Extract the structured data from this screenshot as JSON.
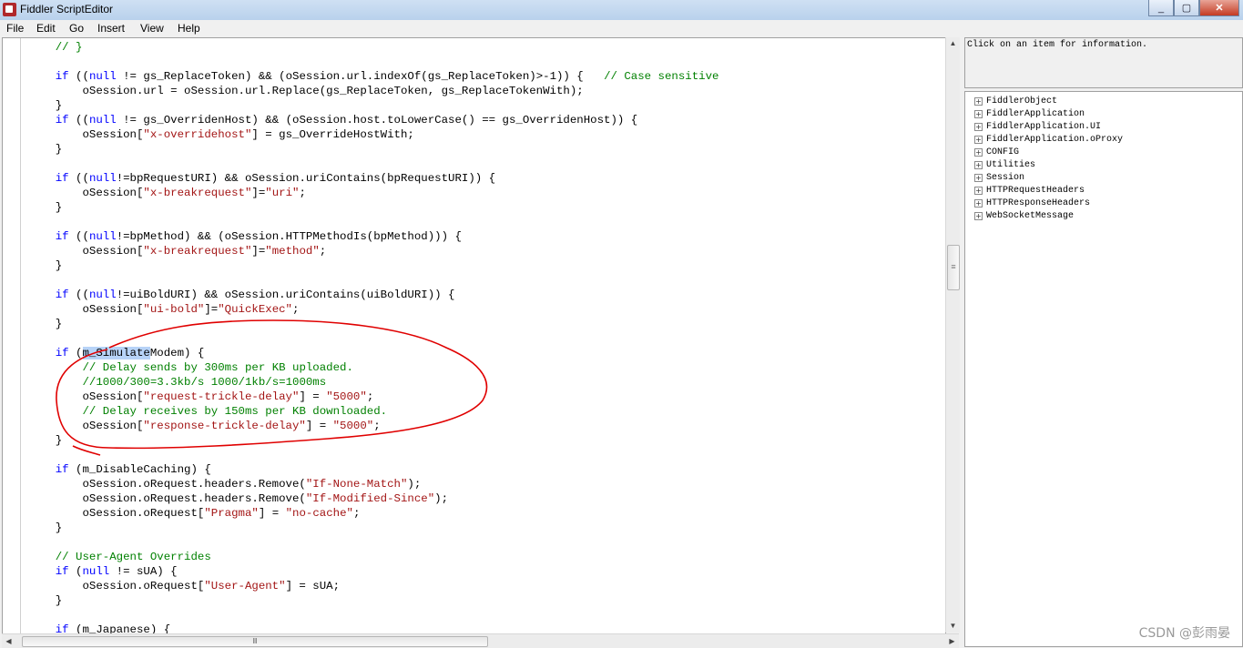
{
  "window": {
    "title": "Fiddler ScriptEditor",
    "minimize": "_",
    "maximize": "▢",
    "close": "✕"
  },
  "menu": [
    "File",
    "Edit",
    "Go",
    "Insert",
    "View",
    "Help"
  ],
  "code": {
    "lines": [
      [
        {
          "t": "    "
        },
        {
          "c": "cm",
          "t": "// }"
        }
      ],
      [
        {
          "t": ""
        }
      ],
      [
        {
          "t": "    "
        },
        {
          "c": "kw",
          "t": "if"
        },
        {
          "t": " (("
        },
        {
          "c": "kw",
          "t": "null"
        },
        {
          "t": " != gs_ReplaceToken) && (oSession.url.indexOf(gs_ReplaceToken)>-1)) {   "
        },
        {
          "c": "cm",
          "t": "// Case sensitive"
        }
      ],
      [
        {
          "t": "        oSession.url = oSession.url.Replace(gs_ReplaceToken, gs_ReplaceTokenWith);"
        }
      ],
      [
        {
          "t": "    }"
        }
      ],
      [
        {
          "t": "    "
        },
        {
          "c": "kw",
          "t": "if"
        },
        {
          "t": " (("
        },
        {
          "c": "kw",
          "t": "null"
        },
        {
          "t": " != gs_OverridenHost) && (oSession.host.toLowerCase() == gs_OverridenHost)) {"
        }
      ],
      [
        {
          "t": "        oSession["
        },
        {
          "c": "st",
          "t": "\"x-overridehost\""
        },
        {
          "t": "] = gs_OverrideHostWith;"
        }
      ],
      [
        {
          "t": "    }"
        }
      ],
      [
        {
          "t": ""
        }
      ],
      [
        {
          "t": "    "
        },
        {
          "c": "kw",
          "t": "if"
        },
        {
          "t": " (("
        },
        {
          "c": "kw",
          "t": "null"
        },
        {
          "t": "!=bpRequestURI) && oSession.uriContains(bpRequestURI)) {"
        }
      ],
      [
        {
          "t": "        oSession["
        },
        {
          "c": "st",
          "t": "\"x-breakrequest\""
        },
        {
          "t": "]="
        },
        {
          "c": "st",
          "t": "\"uri\""
        },
        {
          "t": ";"
        }
      ],
      [
        {
          "t": "    }"
        }
      ],
      [
        {
          "t": ""
        }
      ],
      [
        {
          "t": "    "
        },
        {
          "c": "kw",
          "t": "if"
        },
        {
          "t": " (("
        },
        {
          "c": "kw",
          "t": "null"
        },
        {
          "t": "!=bpMethod) && (oSession.HTTPMethodIs(bpMethod))) {"
        }
      ],
      [
        {
          "t": "        oSession["
        },
        {
          "c": "st",
          "t": "\"x-breakrequest\""
        },
        {
          "t": "]="
        },
        {
          "c": "st",
          "t": "\"method\""
        },
        {
          "t": ";"
        }
      ],
      [
        {
          "t": "    }"
        }
      ],
      [
        {
          "t": ""
        }
      ],
      [
        {
          "t": "    "
        },
        {
          "c": "kw",
          "t": "if"
        },
        {
          "t": " (("
        },
        {
          "c": "kw",
          "t": "null"
        },
        {
          "t": "!=uiBoldURI) && oSession.uriContains(uiBoldURI)) {"
        }
      ],
      [
        {
          "t": "        oSession["
        },
        {
          "c": "st",
          "t": "\"ui-bold\""
        },
        {
          "t": "]="
        },
        {
          "c": "st",
          "t": "\"QuickExec\""
        },
        {
          "t": ";"
        }
      ],
      [
        {
          "t": "    }"
        }
      ],
      [
        {
          "t": ""
        }
      ],
      [
        {
          "t": "    "
        },
        {
          "c": "kw",
          "t": "if"
        },
        {
          "t": " ("
        },
        {
          "c": "hl",
          "t": "m_Simulate"
        },
        {
          "t": "Modem) {"
        }
      ],
      [
        {
          "t": "        "
        },
        {
          "c": "cm",
          "t": "// Delay sends by 300ms per KB uploaded."
        }
      ],
      [
        {
          "t": "        "
        },
        {
          "c": "cm",
          "t": "//1000/300=3.3kb/s 1000/1kb/s=1000ms"
        }
      ],
      [
        {
          "t": "        oSession["
        },
        {
          "c": "st",
          "t": "\"request-trickle-delay\""
        },
        {
          "t": "] = "
        },
        {
          "c": "st",
          "t": "\"5000\""
        },
        {
          "t": ";"
        }
      ],
      [
        {
          "t": "        "
        },
        {
          "c": "cm",
          "t": "// Delay receives by 150ms per KB downloaded."
        }
      ],
      [
        {
          "t": "        oSession["
        },
        {
          "c": "st",
          "t": "\"response-trickle-delay\""
        },
        {
          "t": "] = "
        },
        {
          "c": "st",
          "t": "\"5000\""
        },
        {
          "t": ";"
        }
      ],
      [
        {
          "t": "    }"
        }
      ],
      [
        {
          "t": ""
        }
      ],
      [
        {
          "t": "    "
        },
        {
          "c": "kw",
          "t": "if"
        },
        {
          "t": " (m_DisableCaching) {"
        }
      ],
      [
        {
          "t": "        oSession.oRequest.headers.Remove("
        },
        {
          "c": "st",
          "t": "\"If-None-Match\""
        },
        {
          "t": ");"
        }
      ],
      [
        {
          "t": "        oSession.oRequest.headers.Remove("
        },
        {
          "c": "st",
          "t": "\"If-Modified-Since\""
        },
        {
          "t": ");"
        }
      ],
      [
        {
          "t": "        oSession.oRequest["
        },
        {
          "c": "st",
          "t": "\"Pragma\""
        },
        {
          "t": "] = "
        },
        {
          "c": "st",
          "t": "\"no-cache\""
        },
        {
          "t": ";"
        }
      ],
      [
        {
          "t": "    }"
        }
      ],
      [
        {
          "t": ""
        }
      ],
      [
        {
          "t": "    "
        },
        {
          "c": "cm",
          "t": "// User-Agent Overrides"
        }
      ],
      [
        {
          "t": "    "
        },
        {
          "c": "kw",
          "t": "if"
        },
        {
          "t": " ("
        },
        {
          "c": "kw",
          "t": "null"
        },
        {
          "t": " != sUA) {"
        }
      ],
      [
        {
          "t": "        oSession.oRequest["
        },
        {
          "c": "st",
          "t": "\"User-Agent\""
        },
        {
          "t": "] = sUA;"
        }
      ],
      [
        {
          "t": "    }"
        }
      ],
      [
        {
          "t": ""
        }
      ],
      [
        {
          "t": "    "
        },
        {
          "c": "kw",
          "t": "if"
        },
        {
          "t": " (m_Japanese) {"
        }
      ]
    ]
  },
  "info": {
    "text": "Click on an item for information."
  },
  "tree": {
    "items": [
      "FiddlerObject",
      "FiddlerApplication",
      "FiddlerApplication.UI",
      "FiddlerApplication.oProxy",
      "CONFIG",
      "Utilities",
      "Session",
      "HTTPRequestHeaders",
      "HTTPResponseHeaders",
      "WebSocketMessage"
    ],
    "expander": "+"
  },
  "scroll": {
    "grip": "≡",
    "hgrip": "Ⅲ"
  },
  "watermark": "CSDN @彭雨晏",
  "colors": {
    "keyword": "#0000ff",
    "comment": "#008000",
    "string": "#a31515",
    "selection": "#b7d3f7",
    "annotation": "#e00000"
  }
}
